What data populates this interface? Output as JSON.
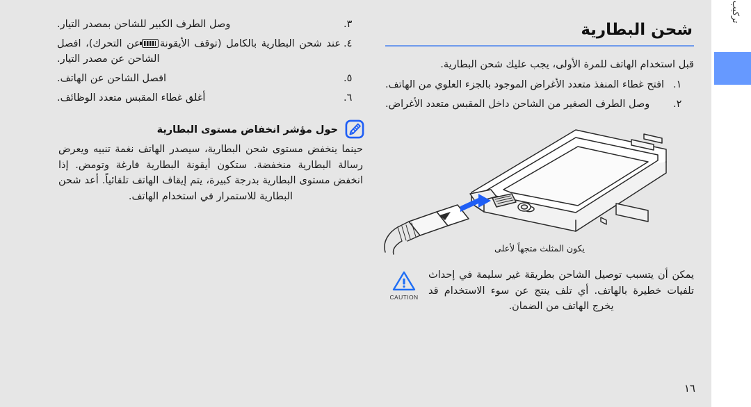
{
  "page": {
    "number": "١٦",
    "background_color": "#e6e6e6",
    "accent_color": "#6699ff",
    "rule_color": "#6f9aec"
  },
  "sidebar": {
    "label": "تركيب وتجهيز هاتفك الجوال",
    "tab_color": "#6699ff"
  },
  "section": {
    "heading": "شحن البطارية",
    "intro": "قبل استخدام الهاتف للمرة الأولى، يجب عليك شحن البطارية."
  },
  "steps": [
    {
      "num": "١.",
      "text": "افتح غطاء المنفذ متعدد الأغراض الموجود بالجزء العلوي من الهاتف."
    },
    {
      "num": "٢.",
      "text": "وصل الطرف الصغير من الشاحن داخل المقبس متعدد الأغراض."
    },
    {
      "num": "٣.",
      "text": "وصل الطرف الكبير للشاحن بمصدر التيار."
    },
    {
      "num": "٤.",
      "text_before": "عند شحن البطارية بالكامل (توقف الأيقونة",
      "icon": "battery-icon",
      "text_after": "عن التحرك)، افصل الشاحن عن مصدر التيار."
    },
    {
      "num": "٥.",
      "text": "افصل الشاحن عن الهاتف."
    },
    {
      "num": "٦.",
      "text": "أغلق غطاء المقبس متعدد الوظائف."
    }
  ],
  "note": {
    "icon": "note-pencil-icon",
    "icon_color": "#1f5ef5",
    "title": "حول مؤشر انخفاض مستوى البطارية",
    "body": "حينما ينخفض مستوى شحن البطارية، سيصدر الهاتف نغمة تنبيه ويعرض رسالة البطارية منخفضة. ستكون أيقونة البطارية فارغة وتومض. إذا انخفض مستوى البطارية بدرجة كبيرة، يتم إيقاف الهاتف تلقائياً. أعد شحن البطارية للاستمرار في استخدام الهاتف."
  },
  "figure": {
    "name": "phone-charging-illustration",
    "caption": "يكون المثلث متجهاً لأعلى",
    "arrow_color": "#1f5ef5"
  },
  "caution": {
    "icon": "caution-triangle-icon",
    "icon_color": "#1f6ef5",
    "label": "CAUTION",
    "text": "يمكن أن يتسبب توصيل الشاحن بطريقة غير سليمة في إحداث تلفيات خطيرة بالهاتف. أي تلف ينتج عن سوء الاستخدام قد يخرج الهاتف من الضمان."
  }
}
